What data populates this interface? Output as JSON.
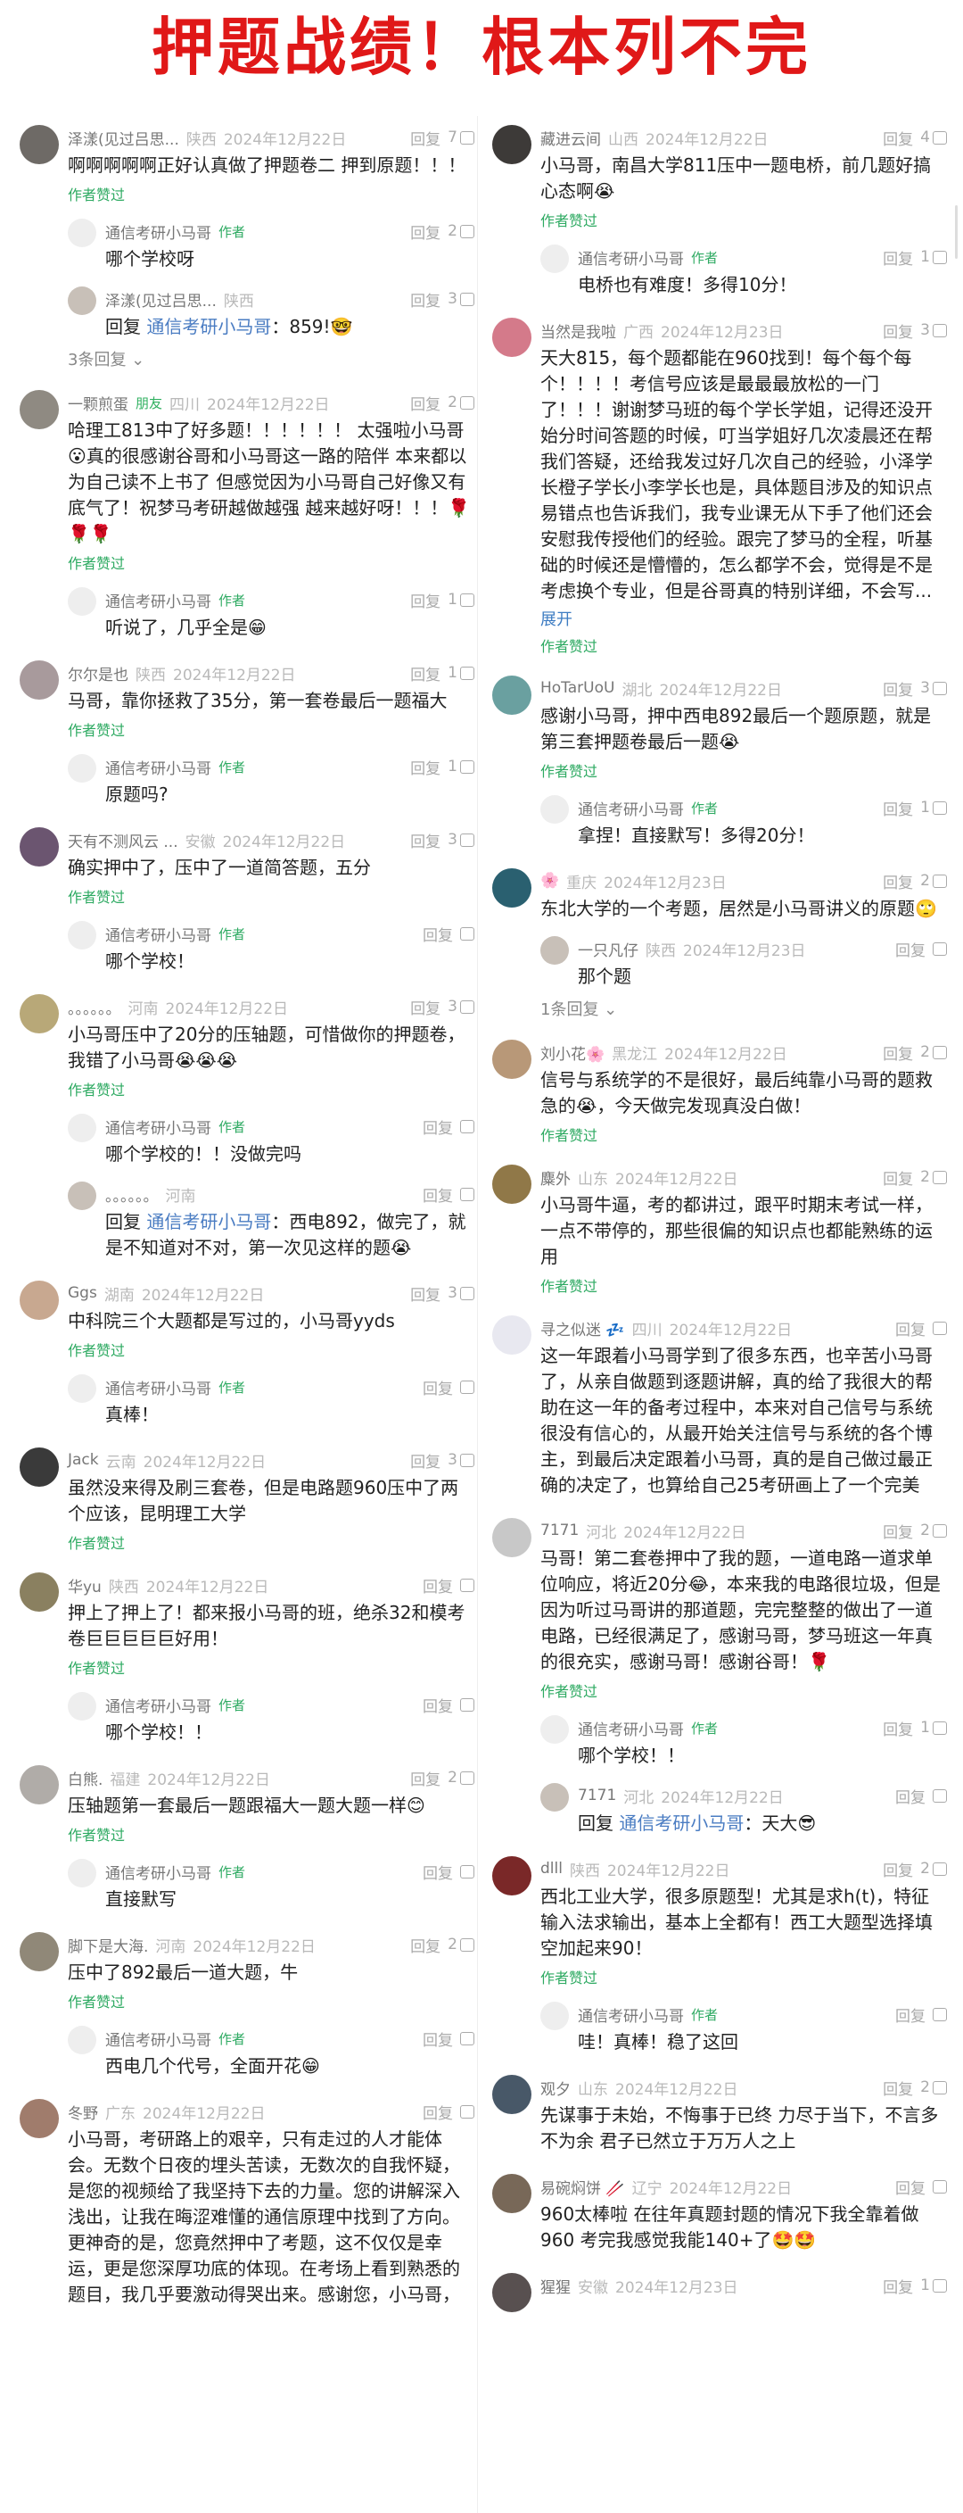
{
  "banner": {
    "title": "押题战绩！根本列不完"
  },
  "labels": {
    "reply": "回复",
    "liked": "作者赞过",
    "author": "作者",
    "expand": "展开",
    "reply_prefix": "回复 "
  },
  "left": [
    {
      "user": "泽漾(见过吕思...",
      "region": "陕西",
      "date": "2024年12月22日",
      "likes": "7",
      "text": "啊啊啊啊啊正好认真做了押题卷二 押到原题！！！",
      "liked": true,
      "av": "#6e6a66",
      "replies": [
        {
          "user": "通信考研小马哥",
          "author": true,
          "likes": "2",
          "text": "哪个学校呀"
        },
        {
          "user": "泽漾(见过吕思...",
          "region": "陕西",
          "likes": "3",
          "to": "通信考研小马哥",
          "text": "：859!🤓"
        }
      ],
      "count": "3条回复 ⌄"
    },
    {
      "user": "一颗煎蛋",
      "badge": "朋友",
      "region": "四川",
      "date": "2024年12月22日",
      "likes": "2",
      "text": "哈理工813中了好多题！！！！！！ 太强啦小马哥😮真的很感谢谷哥和小马哥这一路的陪伴 本来都以为自己读不上书了 但感觉因为小马哥自己好像又有底气了！祝梦马考研越做越强 越来越好呀！！！🌹🌹🌹",
      "liked": true,
      "av": "#8f8a82",
      "replies": [
        {
          "user": "通信考研小马哥",
          "author": true,
          "likes": "1",
          "text": "听说了，几乎全是😁"
        }
      ]
    },
    {
      "user": "尔尔是也",
      "region": "陕西",
      "date": "2024年12月22日",
      "likes": "1",
      "text": "马哥，靠你拯救了35分，第一套卷最后一题福大",
      "liked": true,
      "av": "#a89a9c",
      "replies": [
        {
          "user": "通信考研小马哥",
          "author": true,
          "likes": "1",
          "text": "原题吗?"
        }
      ]
    },
    {
      "user": "天有不测风云 ...",
      "region": "安徽",
      "date": "2024年12月22日",
      "likes": "3",
      "text": "确实押中了，压中了一道简答题，五分",
      "liked": true,
      "av": "#6b5570",
      "replies": [
        {
          "user": "通信考研小马哥",
          "author": true,
          "likes": "",
          "text": "哪个学校！"
        }
      ]
    },
    {
      "user": "。。。。。。",
      "region": "河南",
      "date": "2024年12月22日",
      "likes": "3",
      "text": "小马哥压中了20分的压轴题，可惜做你的押题卷，我错了小马哥😭😭😭",
      "liked": true,
      "av": "#b8a878",
      "replies": [
        {
          "user": "通信考研小马哥",
          "author": true,
          "likes": "",
          "text": "哪个学校的！！没做完吗"
        },
        {
          "user": "。。。。。。",
          "region": "河南",
          "likes": "",
          "to": "通信考研小马哥",
          "text": "：西电892，做完了，就是不知道对不对，第一次见这样的题😭"
        }
      ]
    },
    {
      "user": "Ggs",
      "region": "湖南",
      "date": "2024年12月22日",
      "likes": "3",
      "text": "中科院三个大题都是写过的，小马哥yyds",
      "liked": true,
      "av": "#c8a890",
      "replies": [
        {
          "user": "通信考研小马哥",
          "author": true,
          "likes": "",
          "text": "真棒！"
        }
      ]
    },
    {
      "user": "Jack",
      "region": "云南",
      "date": "2024年12月22日",
      "likes": "3",
      "text": "虽然没来得及刷三套卷，但是电路题960压中了两个应该，昆明理工大学",
      "liked": true,
      "av": "#3a3a3a",
      "replies": []
    },
    {
      "user": "华yu",
      "region": "陕西",
      "date": "2024年12月22日",
      "likes": "",
      "text": "押上了押上了！都来报小马哥的班，绝杀32和模考卷巨巨巨巨巨好用！",
      "liked": true,
      "av": "#8a8060",
      "replies": [
        {
          "user": "通信考研小马哥",
          "author": true,
          "likes": "",
          "text": "哪个学校！！"
        }
      ]
    },
    {
      "user": "白熊.",
      "region": "福建",
      "date": "2024年12月22日",
      "likes": "2",
      "text": "压轴题第一套最后一题跟福大一题大题一样😊",
      "liked": true,
      "av": "#b0aca8",
      "replies": [
        {
          "user": "通信考研小马哥",
          "author": true,
          "likes": "",
          "text": "直接默写"
        }
      ]
    },
    {
      "user": "脚下是大海.",
      "region": "河南",
      "date": "2024年12月22日",
      "likes": "2",
      "text": "压中了892最后一道大题，牛",
      "liked": true,
      "av": "#908878",
      "replies": [
        {
          "user": "通信考研小马哥",
          "author": true,
          "likes": "",
          "text": "西电几个代号，全面开花😁"
        }
      ]
    },
    {
      "user": "冬野",
      "region": "广东",
      "date": "2024年12月22日",
      "likes": "",
      "text": "小马哥，考研路上的艰辛，只有走过的人才能体会。无数个日夜的埋头苦读，无数次的自我怀疑，是您的视频给了我坚持下去的力量。您的讲解深入浅出，让我在晦涩难懂的通信原理中找到了方向。更神奇的是，您竟然押中了考题，这不仅仅是幸运，更是您深厚功底的体现。在考场上看到熟悉的题目，我几乎要激动得哭出来。感谢您，小马哥，",
      "liked": false,
      "av": "#a07c6c",
      "replies": []
    }
  ],
  "right": [
    {
      "user": "藏进云间",
      "region": "山西",
      "date": "2024年12月22日",
      "likes": "4",
      "text": "小马哥，南昌大学811压中一题电桥，前几题好搞心态啊😭",
      "liked": true,
      "av": "#3d3a38",
      "replies": [
        {
          "user": "通信考研小马哥",
          "author": true,
          "likes": "1",
          "text": "电桥也有难度！多得10分！"
        }
      ]
    },
    {
      "user": "当然是我啦",
      "region": "广西",
      "date": "2024年12月23日",
      "likes": "3",
      "text": "天大815，每个题都能在960找到！每个每个每个！！！！考信号应该是最最最放松的一门了！！！谢谢梦马班的每个学长学姐，记得还没开始分时间答题的时候，叮当学姐好几次凌晨还在帮我们答疑，还给我发过好几次自己的经验，小泽学长橙子学长小李学长也是，具体题目涉及的知识点易错点也告诉我们，我专业课无从下手了他们还会安慰我传授他们的经验。跟完了梦马的全程，听基础的时候还是懵懵的，怎么都学不会，觉得是不是考虑换个专业，但是谷哥真的特别详细，不会写...",
      "more": true,
      "liked": true,
      "av": "#d47a8a",
      "replies": []
    },
    {
      "user": "HoTarUoU",
      "region": "湖北",
      "date": "2024年12月22日",
      "likes": "3",
      "text": "感谢小马哥，押中西电892最后一个题原题，就是第三套押题卷最后一题😭",
      "liked": true,
      "av": "#6aa0a0",
      "replies": [
        {
          "user": "通信考研小马哥",
          "author": true,
          "likes": "1",
          "text": "拿捏！直接默写！多得20分！"
        }
      ]
    },
    {
      "user": "🌸",
      "region": "重庆",
      "date": "2024年12月23日",
      "likes": "2",
      "text": "东北大学的一个考题，居然是小马哥讲义的原题🙄",
      "liked": false,
      "av": "#2a6070",
      "replies": [
        {
          "user": "一只凡仔",
          "region": "陕西",
          "date": "2024年12月23日",
          "likes": "",
          "text": "那个题"
        }
      ],
      "count": "1条回复 ⌄"
    },
    {
      "user": "刘小花🌸",
      "region": "黑龙江",
      "date": "2024年12月22日",
      "likes": "2",
      "text": "信号与系统学的不是很好，最后纯靠小马哥的题救急的😭，今天做完发现真没白做！",
      "liked": true,
      "av": "#b89878",
      "replies": []
    },
    {
      "user": "麋外",
      "region": "山东",
      "date": "2024年12月22日",
      "likes": "2",
      "text": "小马哥牛逼，考的都讲过，跟平时期末考试一样，一点不带停的，那些很偏的知识点也都能熟练的运用",
      "liked": true,
      "av": "#907848",
      "replies": []
    },
    {
      "user": "寻之似迷 💤",
      "region": "四川",
      "date": "2024年12月22日",
      "likes": "",
      "text": "这一年跟着小马哥学到了很多东西，也辛苦小马哥了，从亲自做题到逐题讲解，真的给了我很大的帮助在这一年的备考过程中，本来对自己信号与系统很没有信心的，从最开始关注信号与系统的各个博主，到最后决定跟着小马哥，真的是自己做过最正确的决定了，也算给自己25考研画上了一个完美",
      "liked": false,
      "av": "#e8e8f0",
      "replies": []
    },
    {
      "user": "7171",
      "region": "河北",
      "date": "2024年12月22日",
      "likes": "2",
      "text": "马哥！第二套卷押中了我的题，一道电路一道求单位响应，将近20分😂，本来我的电路很垃圾，但是因为听过马哥讲的那道题，完完整整的做出了一道电路，已经很满足了，感谢马哥，梦马班这一年真的很充实，感谢马哥！感谢谷哥！🌹",
      "liked": true,
      "av": "#c8c8c8",
      "replies": [
        {
          "user": "通信考研小马哥",
          "author": true,
          "likes": "1",
          "text": "哪个学校！！"
        },
        {
          "user": "7171",
          "region": "河北",
          "date": "2024年12月22日",
          "likes": "",
          "to": "通信考研小马哥",
          "text": "：天大😎"
        }
      ]
    },
    {
      "user": "dlll",
      "region": "陕西",
      "date": "2024年12月22日",
      "likes": "2",
      "text": "西北工业大学，很多原题型！尤其是求h(t)，特征输入法求输出，基本上全都有！西工大题型选择填空加起来90！",
      "liked": true,
      "av": "#7a2828",
      "replies": [
        {
          "user": "通信考研小马哥",
          "author": true,
          "likes": "",
          "text": "哇！真棒！稳了这回"
        }
      ]
    },
    {
      "user": "观夕",
      "region": "山东",
      "date": "2024年12月22日",
      "likes": "2",
      "text": "先谋事于未始，不悔事于已终 力尽于当下，不言多不为余 君子已然立于万万人之上",
      "liked": false,
      "av": "#485868",
      "replies": []
    },
    {
      "user": "易碗焖饼 🥢",
      "region": "辽宁",
      "date": "2024年12月22日",
      "likes": "",
      "text": "960太棒啦 在往年真题封题的情况下我全靠着做960 考完我感觉我能140+了🤩🤩",
      "liked": false,
      "av": "#786858",
      "replies": []
    },
    {
      "user": "猩猩",
      "region": "安徽",
      "date": "2024年12月23日",
      "likes": "1",
      "text": "",
      "liked": false,
      "av": "#585050",
      "replies": []
    }
  ]
}
